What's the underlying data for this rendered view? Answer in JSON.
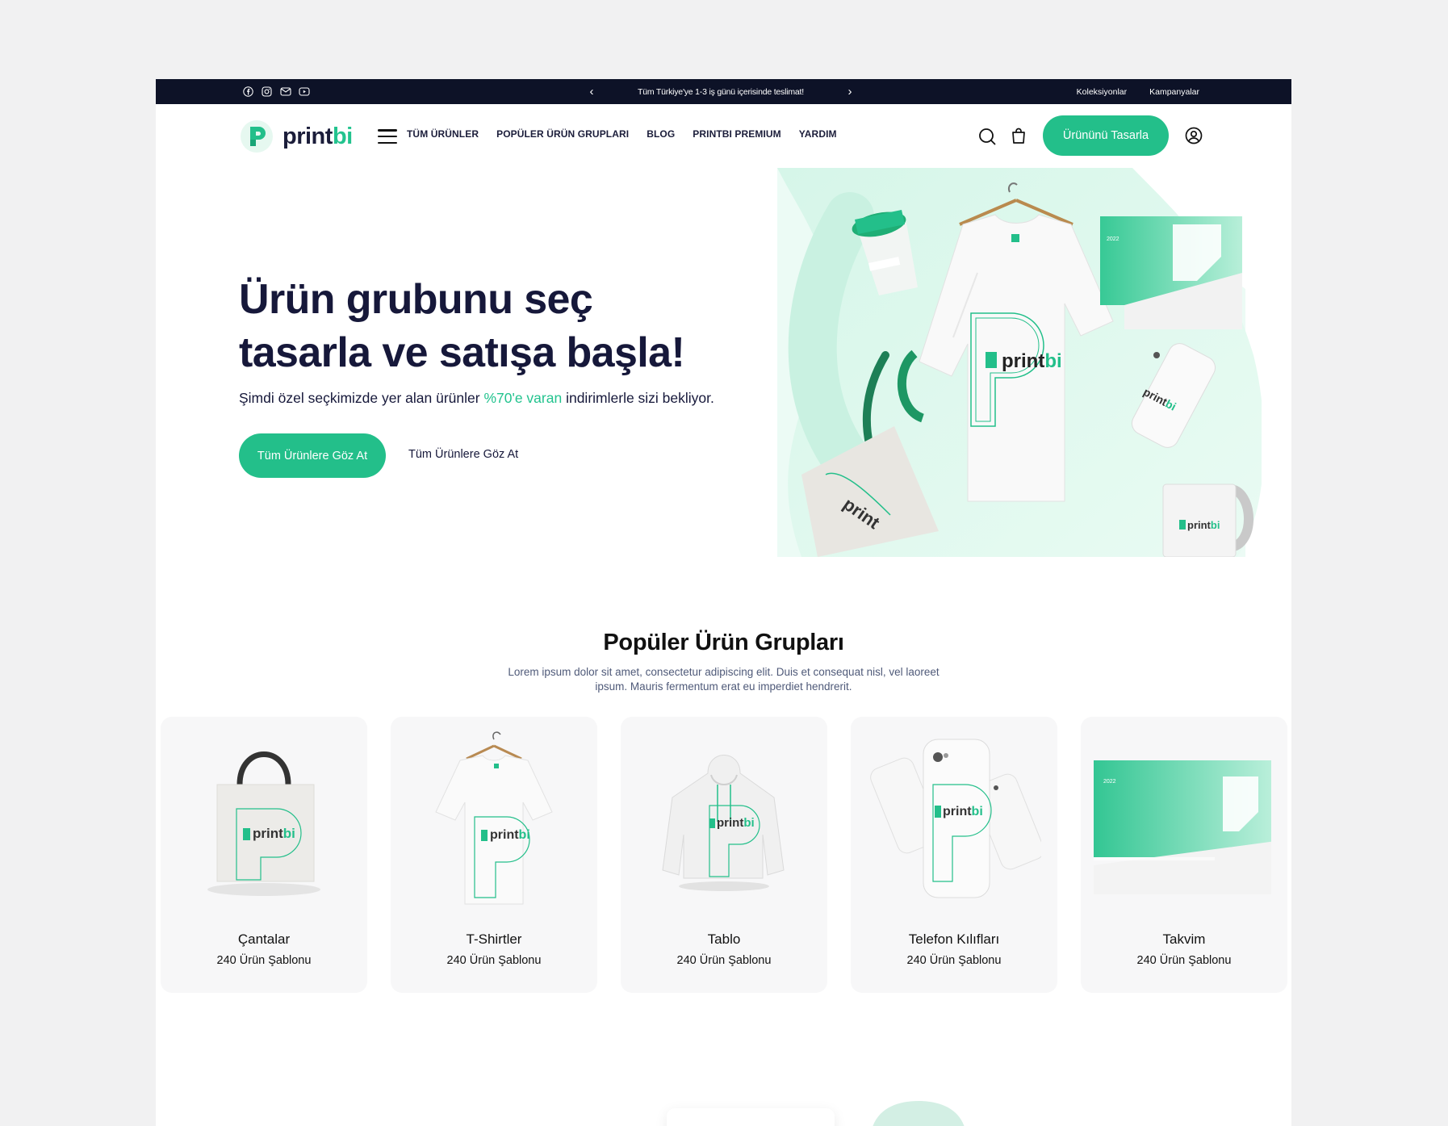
{
  "topbar": {
    "socials": [
      "facebook-icon",
      "instagram-icon",
      "mail-icon",
      "youtube-icon"
    ],
    "announcement": "Tüm Türkiye'ye 1-3 iş günü içerisinde teslimat!",
    "prev": "‹",
    "next": "›",
    "links": [
      "Koleksiyonlar",
      "Kampanyalar"
    ]
  },
  "brand": {
    "name_main": "print",
    "name_accent": "bi"
  },
  "nav": {
    "menu": [
      "TÜM ÜRÜNLER",
      "POPÜLER ÜRÜN GRUPLARI",
      "BLOG",
      "PRINTBI PREMIUM",
      "YARDIM"
    ],
    "cta": "Ürününü Tasarla"
  },
  "hero": {
    "title_line1": "Ürün grubunu seç",
    "title_line2": "tasarla ve satışa başla!",
    "subtitle_before": "Şimdi özel seçkimizde yer alan ürünler ",
    "subtitle_highlight": "%70'e varan",
    "subtitle_after": " indirimlerle sizi bekliyor.",
    "primary_button": "Tüm Ürünlere Göz At",
    "secondary_link": "Tüm Ürünlere Göz At"
  },
  "popular": {
    "title": "Popüler Ürün Grupları",
    "description": "Lorem ipsum dolor sit amet, consectetur adipiscing elit. Duis et consequat nisl, vel laoreet ipsum. Mauris fermentum erat eu imperdiet hendrerit.",
    "cards": [
      {
        "name": "Çantalar",
        "count": "240 Ürün Şablonu"
      },
      {
        "name": "T-Shirtler",
        "count": "240 Ürün Şablonu"
      },
      {
        "name": "Tablo",
        "count": "240 Ürün Şablonu"
      },
      {
        "name": "Telefon Kılıfları",
        "count": "240 Ürün Şablonu"
      },
      {
        "name": "Takvim",
        "count": "240 Ürün Şablonu"
      }
    ]
  },
  "colors": {
    "accent": "#23bf8a",
    "dark": "#0d1227",
    "text": "#16183a"
  }
}
